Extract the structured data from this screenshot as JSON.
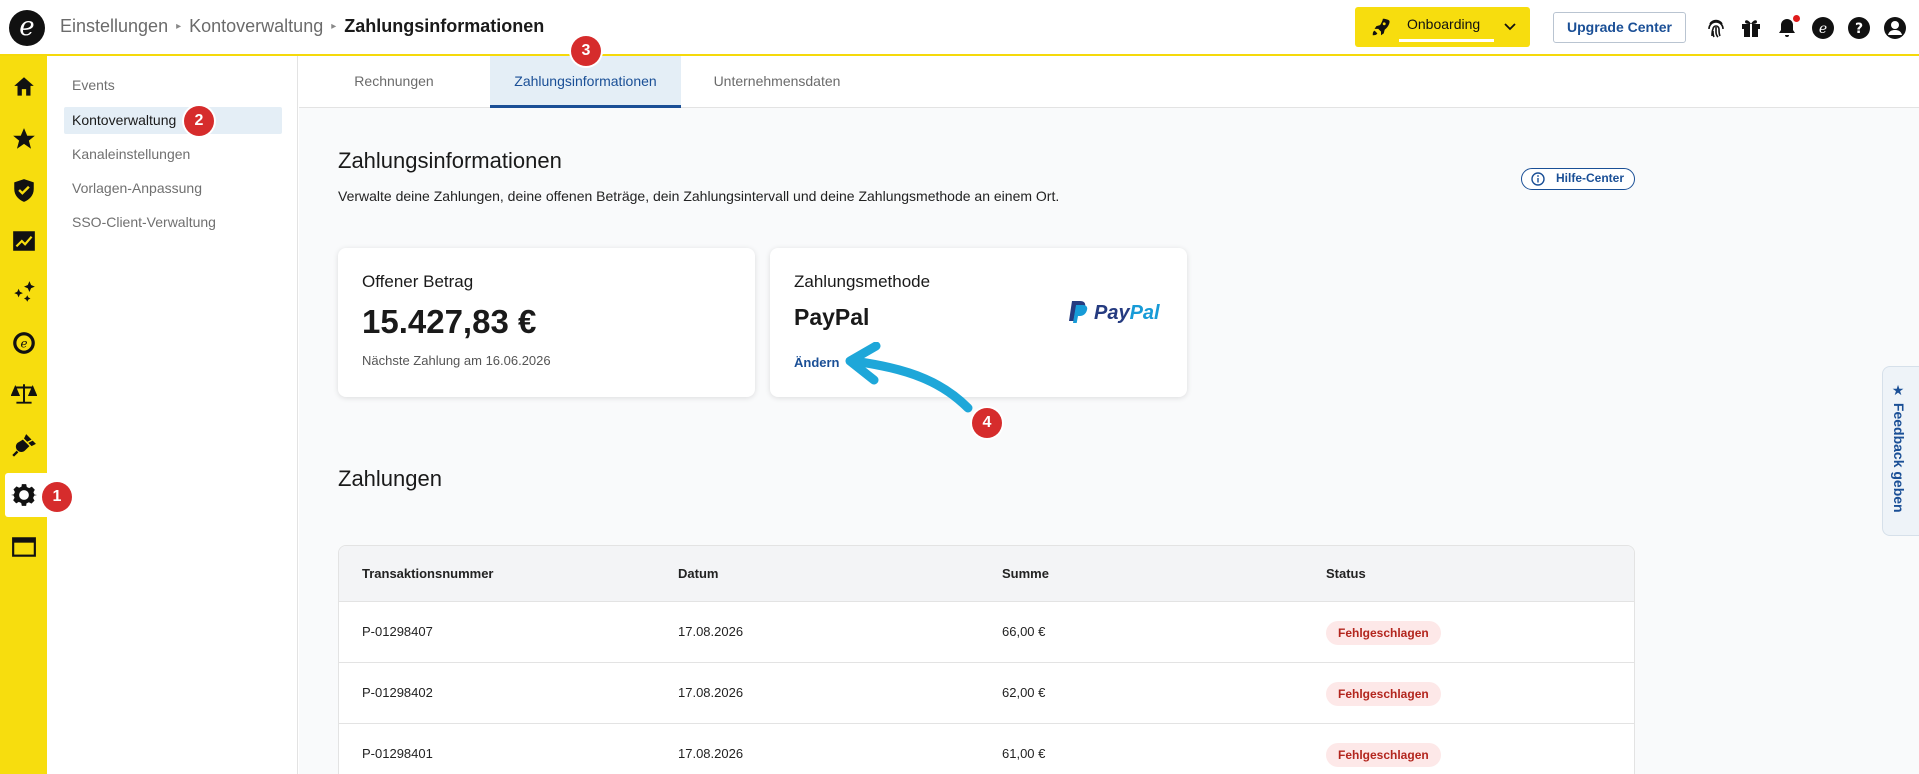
{
  "header": {
    "breadcrumbs": [
      "Einstellungen",
      "Kontoverwaltung",
      "Zahlungsinformationen"
    ],
    "onboarding_label": "Onboarding",
    "upgrade_label": "Upgrade Center"
  },
  "submenu": {
    "items": [
      {
        "label": "Events"
      },
      {
        "label": "Kontoverwaltung"
      },
      {
        "label": "Kanaleinstellungen"
      },
      {
        "label": "Vorlagen-Anpassung"
      },
      {
        "label": "SSO-Client-Verwaltung"
      }
    ]
  },
  "tabs": [
    {
      "label": "Rechnungen"
    },
    {
      "label": "Zahlungsinformationen"
    },
    {
      "label": "Unternehmensdaten"
    }
  ],
  "page": {
    "title": "Zahlungsinformationen",
    "description": "Verwalte deine Zahlungen, deine offenen Beträge, dein Zahlungsintervall und deine Zahlungsmethode an einem Ort.",
    "help_label": "Hilfe-Center"
  },
  "cards": {
    "open": {
      "title": "Offener Betrag",
      "amount": "15.427,83 €",
      "next_payment": "Nächste Zahlung am 16.06.2026"
    },
    "method": {
      "title": "Zahlungsmethode",
      "value": "PayPal",
      "change_label": "Ändern",
      "logo_text_1": "Pay",
      "logo_text_2": "Pal"
    }
  },
  "payments": {
    "title": "Zahlungen",
    "columns": [
      "Transaktionsnummer",
      "Datum",
      "Summe",
      "Status"
    ],
    "rows": [
      {
        "id": "P-01298407",
        "date": "17.08.2026",
        "sum": "66,00 €",
        "status": "Fehlgeschlagen"
      },
      {
        "id": "P-01298402",
        "date": "17.08.2026",
        "sum": "62,00 €",
        "status": "Fehlgeschlagen"
      },
      {
        "id": "P-01298401",
        "date": "17.08.2026",
        "sum": "61,00 €",
        "status": "Fehlgeschlagen"
      }
    ]
  },
  "annotations": {
    "m1": "1",
    "m2": "2",
    "m3": "3",
    "m4": "4"
  },
  "feedback_label": "★ Feedback geben",
  "colors": {
    "brand_yellow": "#f7dd0e",
    "primary_blue": "#1a4f96",
    "error_red": "#b3261e",
    "marker_red": "#d62c2c",
    "arrow_cyan": "#1ea7d9"
  }
}
